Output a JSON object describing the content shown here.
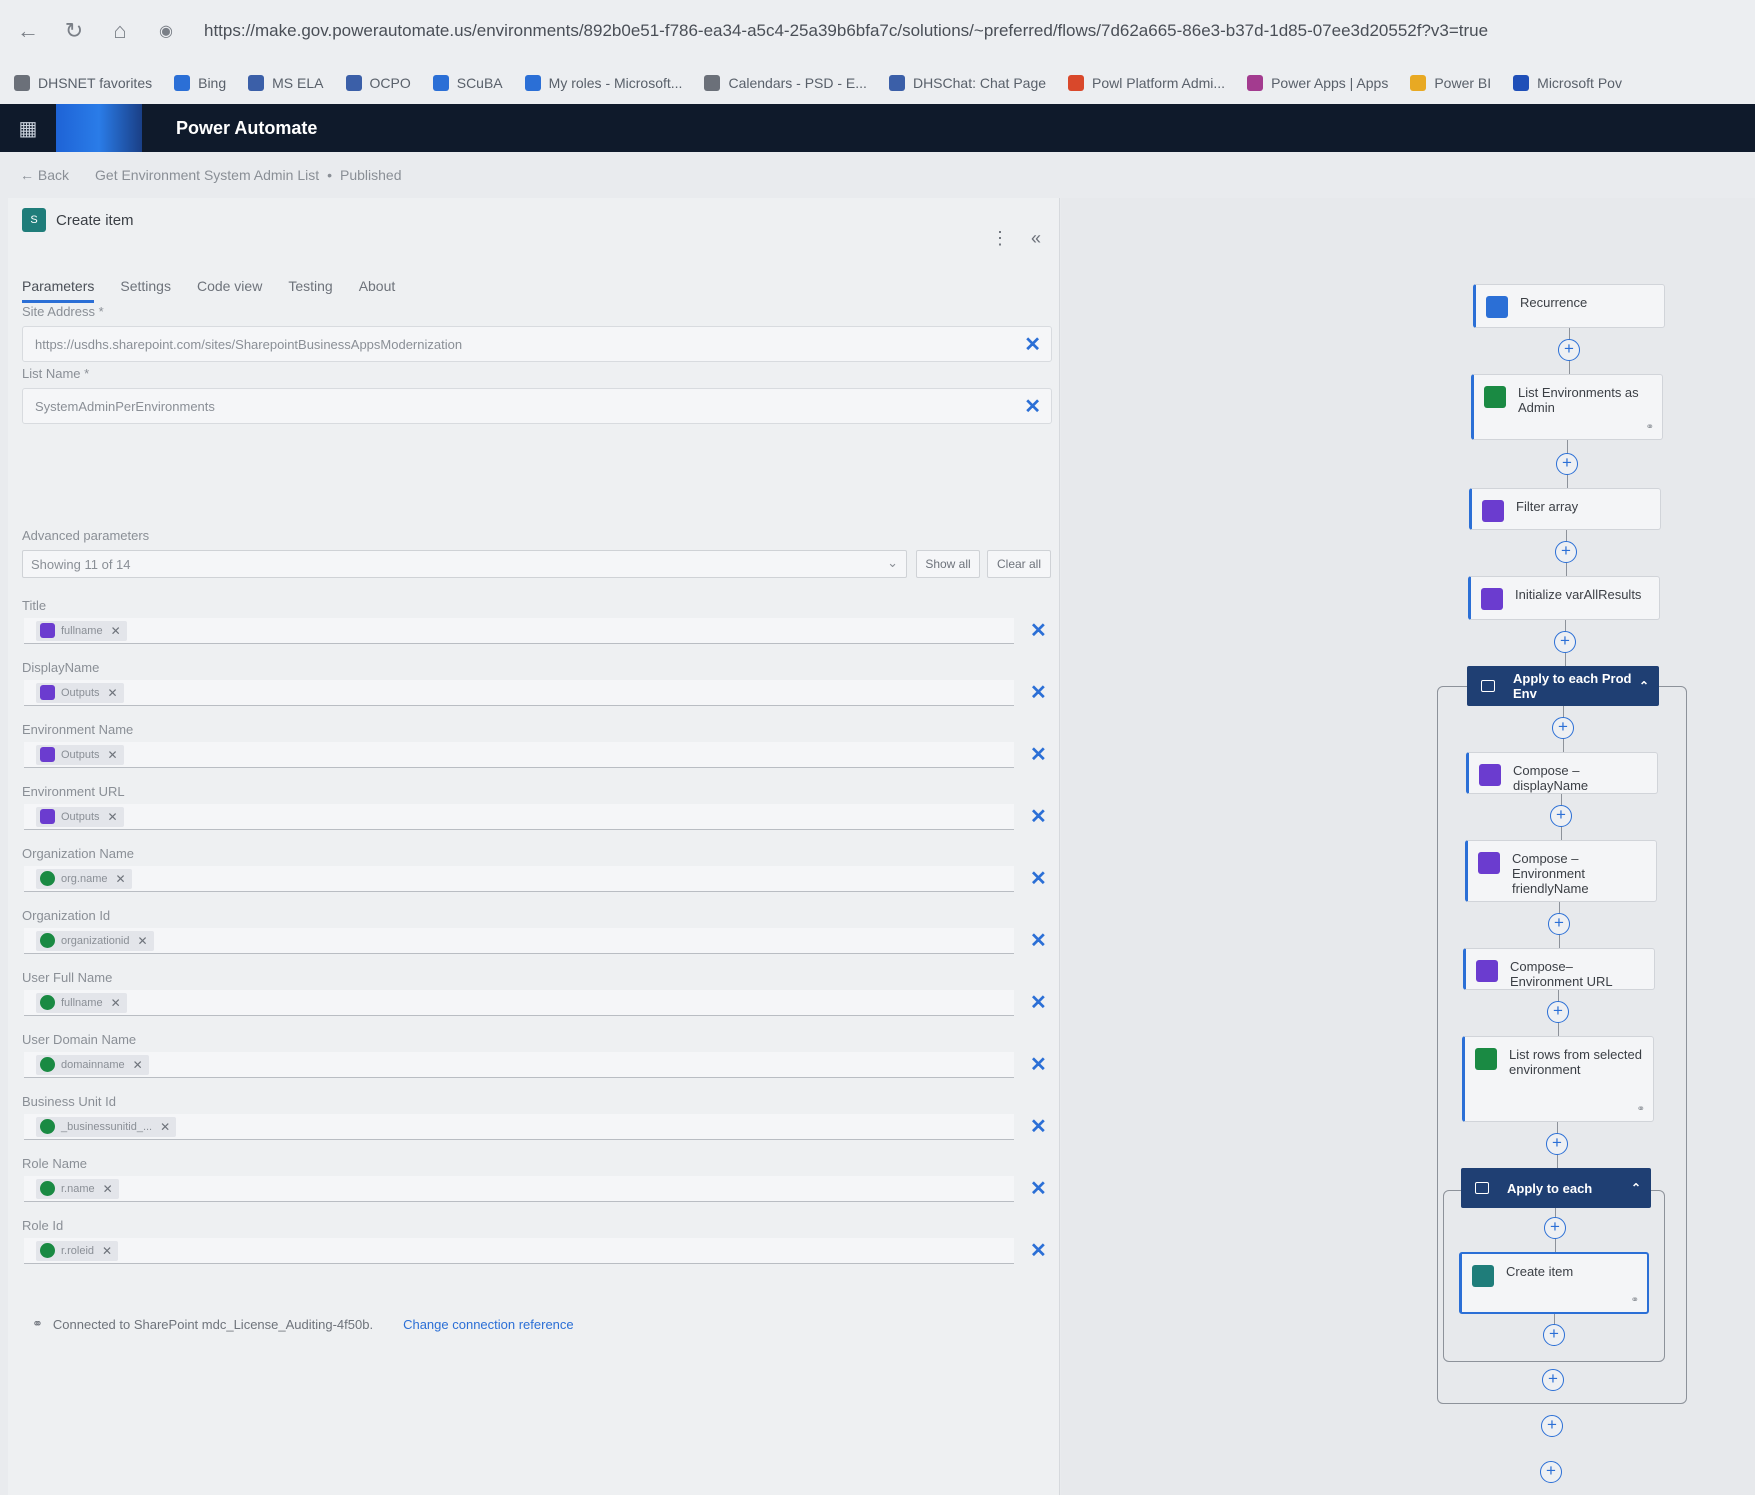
{
  "browser": {
    "url": "https://make.gov.powerautomate.us/environments/892b0e51-f786-ea34-a5c4-25a39b6bfa7c/solutions/~preferred/flows/7d62a665-86e3-b37d-1d85-07ee3d20552f?v3=true",
    "favorites": [
      {
        "label": "DHSNET favorites",
        "color": "#6b7079"
      },
      {
        "label": "Bing",
        "color": "#2b6fd6"
      },
      {
        "label": "MS ELA",
        "color": "#3b5fa8"
      },
      {
        "label": "OCPO",
        "color": "#3b5fa8"
      },
      {
        "label": "SCuBA",
        "color": "#2b6fd6"
      },
      {
        "label": "My roles - Microsoft...",
        "color": "#2b6fd6"
      },
      {
        "label": "Calendars - PSD - E...",
        "color": "#6b7079"
      },
      {
        "label": "DHSChat: Chat Page",
        "color": "#3b5fa8"
      },
      {
        "label": "Powl Platform Admi...",
        "color": "#d9482b"
      },
      {
        "label": "Power Apps | Apps",
        "color": "#a33b8f"
      },
      {
        "label": "Power BI",
        "color": "#e8a923"
      },
      {
        "label": "Microsoft Pov",
        "color": "#1f4fb8"
      }
    ]
  },
  "app": {
    "title": "Power Automate"
  },
  "breadcrumb": {
    "back": "Back",
    "flow": "Get Environment System Admin List",
    "status": "Published"
  },
  "panel": {
    "title": "Create item",
    "tabs": [
      "Parameters",
      "Settings",
      "Code view",
      "Testing",
      "About"
    ],
    "site_address_label": "Site Address *",
    "site_address_value": "https://usdhs.sharepoint.com/sites/SharepointBusinessAppsModernization",
    "list_name_label": "List Name *",
    "list_name_value": "SystemAdminPerEnvironments",
    "advanced_label": "Advanced parameters",
    "advanced_value": "Showing 11 of 14",
    "show_all": "Show all",
    "clear_all": "Clear all",
    "params": [
      {
        "label": "Title",
        "token": "fullname",
        "kind": "purple"
      },
      {
        "label": "DisplayName",
        "token": "Outputs",
        "kind": "purple"
      },
      {
        "label": "Environment Name",
        "token": "Outputs",
        "kind": "purple"
      },
      {
        "label": "Environment URL",
        "token": "Outputs",
        "kind": "purple"
      },
      {
        "label": "Organization Name",
        "token": "org.name",
        "kind": "green"
      },
      {
        "label": "Organization Id",
        "token": "organizationid",
        "kind": "green"
      },
      {
        "label": "User Full Name",
        "token": "fullname",
        "kind": "green"
      },
      {
        "label": "User Domain Name",
        "token": "domainname",
        "kind": "green"
      },
      {
        "label": "Business Unit Id",
        "token": "_businessunitid_...",
        "kind": "green"
      },
      {
        "label": "Role Name",
        "token": "r.name",
        "kind": "green"
      },
      {
        "label": "Role Id",
        "token": "r.roleid",
        "kind": "green"
      }
    ],
    "connection_text": "Connected to SharePoint mdc_License_Auditing-4f50b.",
    "connection_link": "Change connection reference"
  },
  "flow": {
    "nodes": [
      {
        "label": "Recurrence",
        "icon_color": "#2b6fd6"
      },
      {
        "label": "List Environments as Admin",
        "icon_color": "#1a8a43"
      },
      {
        "label": "Filter array",
        "icon_color": "#6b3ccf"
      },
      {
        "label": "Initialize varAllResults",
        "icon_color": "#6b3ccf"
      },
      {
        "label": "Apply to each Prod Env"
      },
      {
        "label": "Compose – displayName",
        "icon_color": "#6b3ccf"
      },
      {
        "label": "Compose – Environment friendlyName",
        "icon_color": "#6b3ccf"
      },
      {
        "label": "Compose– Environment URL",
        "icon_color": "#6b3ccf"
      },
      {
        "label": "List rows from selected environment",
        "icon_color": "#1a8a43"
      },
      {
        "label": "Apply to each"
      },
      {
        "label": "Create item",
        "icon_color": "#1f7d7a"
      }
    ]
  }
}
